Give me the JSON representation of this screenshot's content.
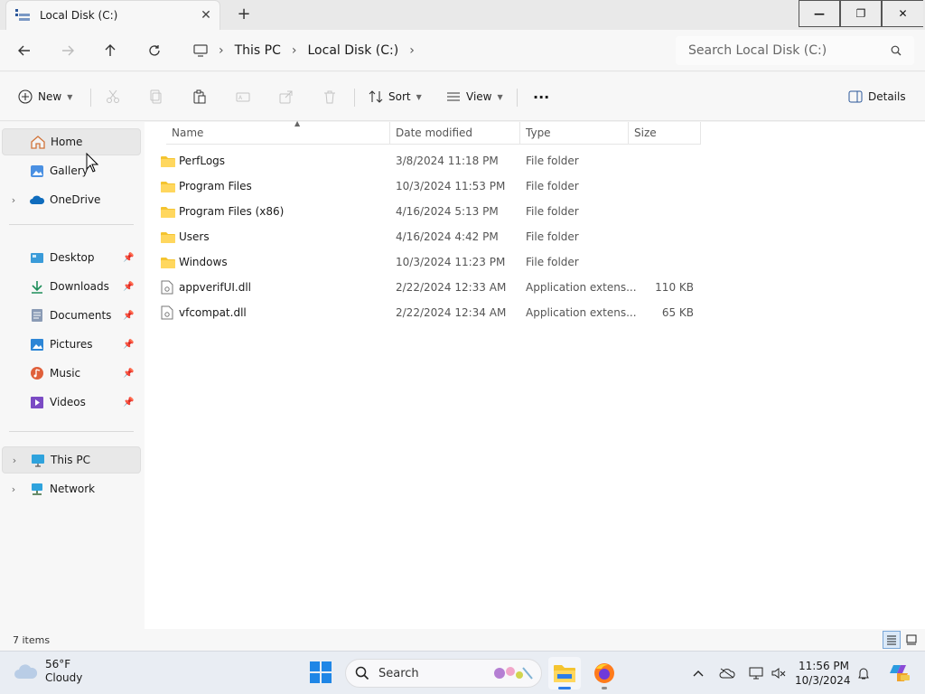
{
  "window": {
    "tab_title": "Local Disk (C:)",
    "tab_close": "✕",
    "new_tab": "+",
    "minimize": "—",
    "maximize": "❐",
    "close": "✕"
  },
  "address": {
    "crumbs": [
      "This PC",
      "Local Disk (C:)"
    ],
    "separator": "›",
    "search_placeholder": "Search Local Disk (C:)"
  },
  "commands": {
    "new_label": "New",
    "sort_label": "Sort",
    "view_label": "View",
    "more_label": "···",
    "details_label": "Details"
  },
  "sidebar": {
    "quick": [
      {
        "label": "Home",
        "icon": "home-icon",
        "selected": true
      },
      {
        "label": "Gallery",
        "icon": "gallery-icon"
      },
      {
        "label": "OneDrive",
        "icon": "onedrive-icon",
        "expandable": true
      }
    ],
    "pinned": [
      {
        "label": "Desktop",
        "icon": "desktop-icon"
      },
      {
        "label": "Downloads",
        "icon": "downloads-icon"
      },
      {
        "label": "Documents",
        "icon": "documents-icon"
      },
      {
        "label": "Pictures",
        "icon": "pictures-icon"
      },
      {
        "label": "Music",
        "icon": "music-icon"
      },
      {
        "label": "Videos",
        "icon": "videos-icon"
      }
    ],
    "devices": [
      {
        "label": "This PC",
        "icon": "this-pc-icon",
        "expandable": true
      },
      {
        "label": "Network",
        "icon": "network-icon",
        "expandable": true
      }
    ]
  },
  "columns": {
    "name": "Name",
    "date": "Date modified",
    "type": "Type",
    "size": "Size"
  },
  "files": [
    {
      "name": "PerfLogs",
      "date": "3/8/2024 11:18 PM",
      "type": "File folder",
      "size": "",
      "kind": "folder"
    },
    {
      "name": "Program Files",
      "date": "10/3/2024 11:53 PM",
      "type": "File folder",
      "size": "",
      "kind": "folder"
    },
    {
      "name": "Program Files (x86)",
      "date": "4/16/2024 5:13 PM",
      "type": "File folder",
      "size": "",
      "kind": "folder"
    },
    {
      "name": "Users",
      "date": "4/16/2024 4:42 PM",
      "type": "File folder",
      "size": "",
      "kind": "folder"
    },
    {
      "name": "Windows",
      "date": "10/3/2024 11:23 PM",
      "type": "File folder",
      "size": "",
      "kind": "folder"
    },
    {
      "name": "appverifUI.dll",
      "date": "2/22/2024 12:33 AM",
      "type": "Application extens...",
      "size": "110 KB",
      "kind": "dll"
    },
    {
      "name": "vfcompat.dll",
      "date": "2/22/2024 12:34 AM",
      "type": "Application extens...",
      "size": "65 KB",
      "kind": "dll"
    }
  ],
  "status": {
    "item_count": "7 items"
  },
  "taskbar": {
    "weather_temp": "56°F",
    "weather_desc": "Cloudy",
    "search_label": "Search",
    "clock_time": "11:56 PM",
    "clock_date": "10/3/2024"
  },
  "colors": {
    "folder": "#f4c430",
    "accent": "#2b7de9"
  }
}
